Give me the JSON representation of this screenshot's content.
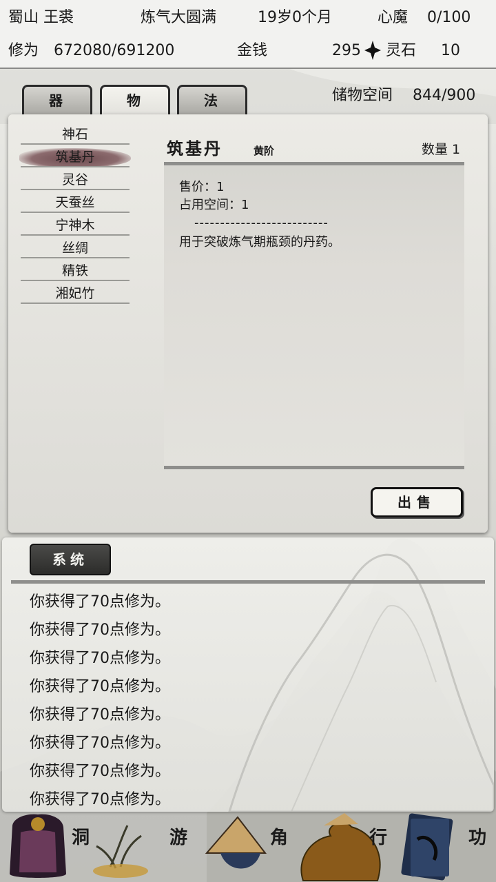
{
  "header": {
    "location_name": "蜀山 王裘",
    "realm": "炼气大圆满",
    "age": "19岁0个月",
    "demon_label": "心魔",
    "demon_value": "0/100",
    "cultivation_label": "修为",
    "cultivation_value": "672080/691200",
    "money_label": "金钱",
    "money_value": "295",
    "spirit_stone_label": "灵石",
    "spirit_stone_value": "10"
  },
  "tabs": [
    {
      "label": "器"
    },
    {
      "label": "物"
    },
    {
      "label": "法"
    }
  ],
  "storage": {
    "label": "储物空间",
    "value": "844/900"
  },
  "items": [
    {
      "label": "神石"
    },
    {
      "label": "筑基丹"
    },
    {
      "label": "灵谷"
    },
    {
      "label": "天蚕丝"
    },
    {
      "label": "宁神木"
    },
    {
      "label": "丝绸"
    },
    {
      "label": "精铁"
    },
    {
      "label": "湘妃竹"
    }
  ],
  "detail": {
    "title": "筑基丹",
    "grade": "黄阶",
    "quantity": "数量 1",
    "price": "售价：1",
    "space": "占用空间：1",
    "separator": "--------------------------",
    "description": "用于突破炼气期瓶颈的丹药。",
    "sell_label": "出售"
  },
  "log": {
    "tab_label": "系统",
    "lines": [
      "你获得了70点修为。",
      "你获得了70点修为。",
      "你获得了70点修为。",
      "你获得了70点修为。",
      "你获得了70点修为。",
      "你获得了70点修为。",
      "你获得了70点修为。",
      "你获得了70点修为。"
    ]
  },
  "nav": {
    "labels": [
      "洞",
      "游",
      "角",
      "行",
      "功"
    ],
    "icons": [
      "character-bag-icon",
      "orchid-icon",
      "straw-hat-icon",
      "item-pouch-icon",
      "book-icon"
    ]
  },
  "colors": {
    "selection": "#7a5a5e",
    "panel": "#e8e7e2",
    "rule": "#8e8e8c"
  }
}
